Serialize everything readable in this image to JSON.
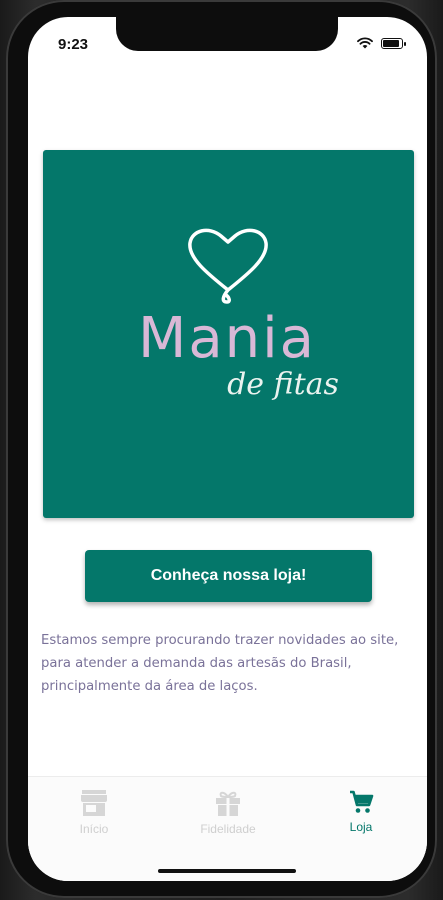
{
  "status_bar": {
    "time": "9:23"
  },
  "banner": {
    "logo_text": "Mania",
    "logo_script": "de fitas",
    "background_color": "#04776a",
    "logo_color": "#d9b8d6",
    "heart_color": "#ffffff"
  },
  "cta": {
    "label": "Conheça nossa loja!"
  },
  "description": "Estamos sempre procurando trazer novidades ao site, para atender a demanda das artesãs do Brasil, principalmente da área de laços.",
  "tabs": [
    {
      "label": "Início",
      "icon": "store-icon",
      "active": false
    },
    {
      "label": "Fidelidade",
      "icon": "gift-icon",
      "active": false
    },
    {
      "label": "Loja",
      "icon": "cart-icon",
      "active": true
    }
  ],
  "colors": {
    "accent": "#04776a",
    "text_muted": "#7a7299"
  }
}
